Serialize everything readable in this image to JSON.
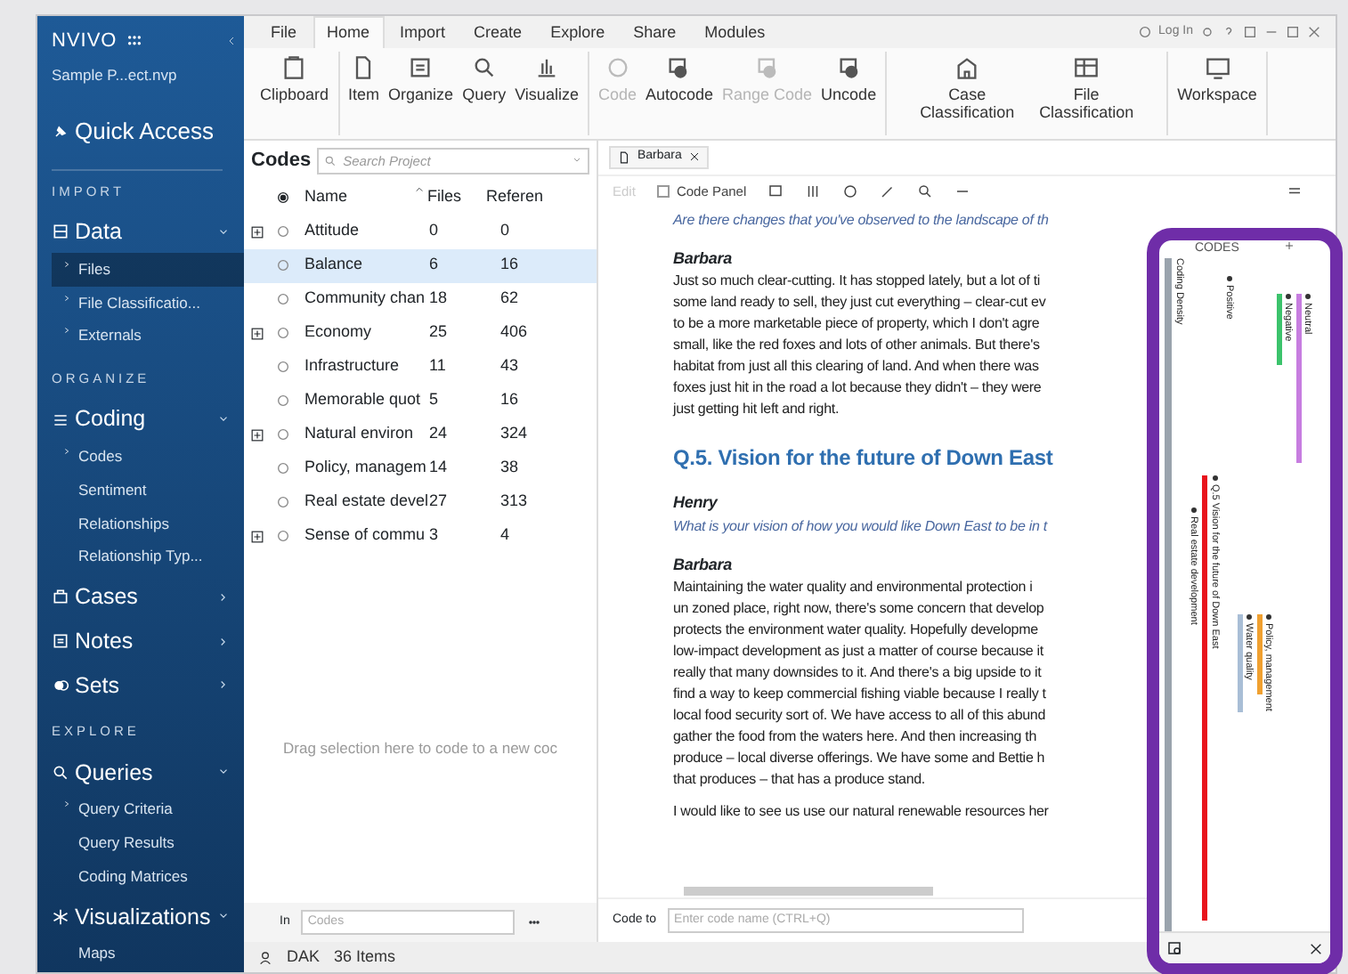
{
  "app": {
    "logo": "NVIVO",
    "project": "Sample P...ect.nvp"
  },
  "sidebar": {
    "groups": [
      {
        "label": "Quick Access"
      },
      {
        "heading": "IMPORT",
        "label": "Data",
        "expanded": true,
        "children": [
          {
            "label": "Files",
            "arrow": true,
            "selected": true
          },
          {
            "label": "File Classificatio...",
            "arrow": true,
            "selected": false
          },
          {
            "label": "Externals",
            "arrow": true,
            "selected": false
          }
        ]
      },
      {
        "heading": "ORGANIZE",
        "label": "Coding",
        "expanded": true,
        "children": [
          {
            "label": "Codes",
            "arrow": true,
            "selected": false
          },
          {
            "label": "Sentiment",
            "arrow": false,
            "selected": false
          },
          {
            "label": "Relationships",
            "arrow": false,
            "selected": false
          },
          {
            "label": "Relationship Typ...",
            "arrow": false,
            "selected": false
          }
        ]
      },
      {
        "label": "Cases",
        "expanded": false
      },
      {
        "label": "Notes",
        "expanded": false
      },
      {
        "label": "Sets",
        "expanded": false
      },
      {
        "heading": "EXPLORE",
        "label": "Queries",
        "expanded": true,
        "children": [
          {
            "label": "Query Criteria",
            "arrow": true,
            "selected": false
          },
          {
            "label": "Query Results",
            "arrow": false,
            "selected": false
          },
          {
            "label": "Coding Matrices",
            "arrow": false,
            "selected": false
          }
        ]
      },
      {
        "label": "Visualizations",
        "expanded": true,
        "children": [
          {
            "label": "Maps",
            "arrow": false,
            "selected": false
          }
        ]
      }
    ]
  },
  "menu_tabs": [
    {
      "label": "File",
      "selected": false
    },
    {
      "label": "Home",
      "selected": true
    },
    {
      "label": "Import",
      "selected": false
    },
    {
      "label": "Create",
      "selected": false
    },
    {
      "label": "Explore",
      "selected": false
    },
    {
      "label": "Share",
      "selected": false
    },
    {
      "label": "Modules",
      "selected": false
    }
  ],
  "login": "Log In",
  "ribbon": [
    [
      {
        "label": "Clipboard",
        "disabled": false
      }
    ],
    [
      {
        "label": "Item",
        "disabled": false
      },
      {
        "label": "Organize",
        "disabled": false
      },
      {
        "label": "Query",
        "disabled": false
      },
      {
        "label": "Visualize",
        "disabled": false
      }
    ],
    [
      {
        "label": "Code",
        "disabled": true
      },
      {
        "label": "Autocode",
        "disabled": false
      },
      {
        "label": "Range Code",
        "disabled": true
      },
      {
        "label": "Uncode",
        "disabled": false
      }
    ],
    [
      {
        "label": "Case Classification",
        "disabled": false
      },
      {
        "label": "File Classification",
        "disabled": false
      }
    ],
    [
      {
        "label": "Workspace",
        "disabled": false
      }
    ]
  ],
  "codes_panel": {
    "title": "Codes",
    "search_placeholder": "Search Project",
    "columns": [
      "Name",
      "Files",
      "Referen"
    ],
    "rows": [
      {
        "name": "Attitude",
        "files": "0",
        "refs": "0",
        "expandable": true,
        "selected": false
      },
      {
        "name": "Balance",
        "files": "6",
        "refs": "16",
        "expandable": false,
        "selected": true
      },
      {
        "name": "Community chan",
        "files": "18",
        "refs": "62",
        "expandable": false,
        "selected": false
      },
      {
        "name": "Economy",
        "files": "25",
        "refs": "406",
        "expandable": true,
        "selected": false
      },
      {
        "name": "Infrastructure",
        "files": "11",
        "refs": "43",
        "expandable": false,
        "selected": false
      },
      {
        "name": "Memorable quot",
        "files": "5",
        "refs": "16",
        "expandable": false,
        "selected": false
      },
      {
        "name": "Natural environ",
        "files": "24",
        "refs": "324",
        "expandable": true,
        "selected": false
      },
      {
        "name": "Policy, managem",
        "files": "14",
        "refs": "38",
        "expandable": false,
        "selected": false
      },
      {
        "name": "Real estate devel",
        "files": "27",
        "refs": "313",
        "expandable": false,
        "selected": false
      },
      {
        "name": "Sense of commu",
        "files": "3",
        "refs": "4",
        "expandable": true,
        "selected": false
      }
    ],
    "drop_hint": "Drag selection here to code to a new coc",
    "in_label": "In",
    "in_placeholder": "Codes"
  },
  "document": {
    "tab": "Barbara",
    "edit": "Edit",
    "code_panel": {
      "label": "Code Panel",
      "checked": false
    },
    "content": [
      {
        "kind": "question",
        "text": "Are there changes that you've observed to the landscape of th"
      },
      {
        "kind": "speaker",
        "text": "Barbara"
      },
      {
        "kind": "paragraph",
        "lines": [
          "Just so much clear-cutting. It has stopped lately, but a lot of ti",
          "some land ready to sell, they just cut everything – clear-cut ev",
          "to be a more marketable piece of property, which I don't agre",
          "small, like the red foxes and lots of other animals. But there's",
          "habitat from just all this clearing of land. And when there was",
          "foxes just hit in the road a lot because they didn't – they were",
          "just getting hit left and right."
        ]
      },
      {
        "kind": "heading",
        "text": "Q.5. Vision for the future of Down East"
      },
      {
        "kind": "speaker",
        "text": "Henry"
      },
      {
        "kind": "question",
        "text": "What is your vision of how you would like Down East to be in t"
      },
      {
        "kind": "speaker",
        "text": "Barbara"
      },
      {
        "kind": "paragraph",
        "lines": [
          "Maintaining the water quality and environmental protection i",
          "un zoned place, right now, there's some concern that develop",
          "protects the environment water quality. Hopefully developme",
          "low-impact development as just a matter of course because it",
          "really that many downsides to it. And there's a big upside to it",
          "find a way to keep commercial fishing viable because I really t",
          "local food security sort of. We have access to all of this abund",
          "gather the food from the waters here. And then increasing th",
          "produce – local diverse offerings. We have some and Bettie h",
          "that produces – that has a produce stand."
        ]
      },
      {
        "kind": "paragraph",
        "lines": [
          "I would like to see us use our natural renewable resources her"
        ]
      }
    ],
    "code_to_label": "Code to",
    "code_to_placeholder": "Enter code name (CTRL+Q)"
  },
  "stripes_panel": {
    "title": "CODES",
    "stripes": [
      {
        "kind": "density",
        "label": "Coding Density",
        "color": "#9aa3ad"
      },
      {
        "kind": "stripe",
        "label": "Real estate development"
      },
      {
        "kind": "stripe",
        "label": "Q.5 Vision for the future of Down East",
        "color": "#e8141c"
      },
      {
        "kind": "stripe",
        "label": "Positive"
      },
      {
        "kind": "stripe",
        "label": "Water quality",
        "color": "#a9bed6"
      },
      {
        "kind": "stripe",
        "label": "Policy, management",
        "color": "#f0a030"
      },
      {
        "kind": "stripe",
        "label": "Negative",
        "color": "#3cc36c"
      },
      {
        "kind": "stripe",
        "label": "Neutral",
        "color": "#c77de0"
      }
    ]
  },
  "status_bar": {
    "user": "DAK",
    "count": "36 Items"
  }
}
